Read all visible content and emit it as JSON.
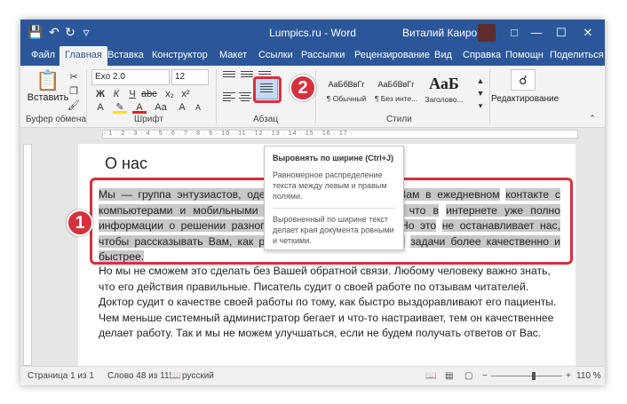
{
  "window": {
    "doc_title": "Lumpics.ru - Word",
    "user_name": "Виталий Каиров"
  },
  "tabs": [
    "Файл",
    "Главная",
    "Вставка",
    "Конструктор",
    "Макет",
    "Ссылки",
    "Рассылки",
    "Рецензирование",
    "Вид",
    "Справка",
    "Помощн",
    "Поделиться"
  ],
  "active_tab": "Главная",
  "ribbon": {
    "paste_label": "Вставить",
    "font_name": "Exo 2.0",
    "font_size": "12",
    "group_clipboard": "Буфер обмена",
    "group_font": "Шрифт",
    "group_paragraph": "Абзац",
    "group_styles": "Стили",
    "editing_label": "Редактирование",
    "styles": [
      {
        "preview": "АаБбВвГг",
        "name": "¶ Обычный"
      },
      {
        "preview": "АаБбВвГг",
        "name": "¶ Без инте..."
      },
      {
        "preview": "АаБ",
        "name": "Заголово..."
      }
    ]
  },
  "tooltip": {
    "title": "Выровнять по ширине (Ctrl+J)",
    "text1": "Равномерное распределение текста между левым и правым полями.",
    "text2": "Выровненный по ширине текст делает края документа ровными и четкими."
  },
  "document": {
    "heading": "О нас",
    "para1_lines": [
      "Мы — группа энтузиастов, одержимых идеей помогать Вам в ежедневном",
      "контакте с компьютерами и мобильными устройствами. Мы знаем, что в",
      "интернете уже полно информации о решении разного рода проблем с ними. Но это",
      "не останавливает нас, чтобы рассказывать Вам, как решать многие проблемы и",
      "задачи более качественно и быстрее."
    ],
    "para2": "Но мы не сможем это сделать без Вашей обратной связи. Любому человеку важно знать, что его действия правильные. Писатель судит о своей работе по отзывам читателей. Доктор судит о качестве своей работы по тому, как быстро выздоравливают его пациенты. Чем меньше системный администратор бегает и что-то настраивает, тем он качественнее делает работу. Так и мы не можем улучшаться, если не будем получать ответов от Вас."
  },
  "callouts": {
    "badge1": "1",
    "badge2": "2"
  },
  "status": {
    "page": "Страница 1 из 1",
    "words": "Слово 48 из 115",
    "language": "русский",
    "zoom": "110 %"
  },
  "colors": {
    "word_blue": "#2b579a",
    "callout_red": "#d6313c"
  }
}
